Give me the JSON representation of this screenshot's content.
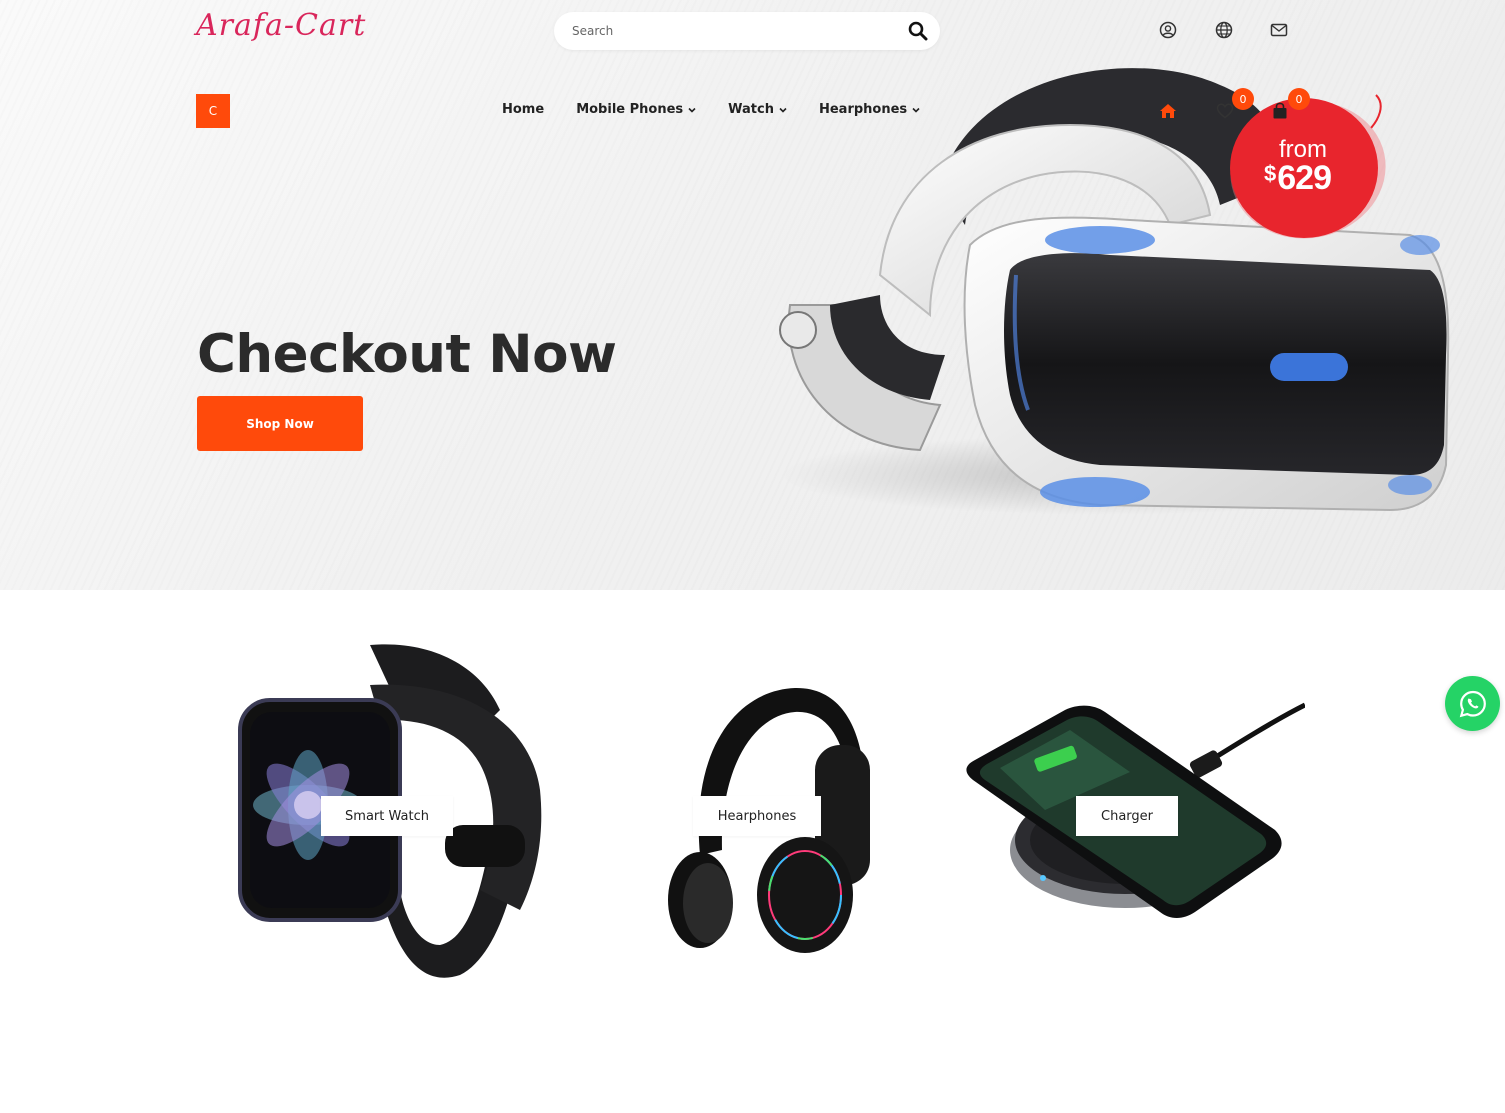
{
  "header": {
    "logo": "Arafa-Cart",
    "search_placeholder": "Search",
    "icons": [
      "user-icon",
      "globe-icon",
      "mail-icon"
    ]
  },
  "nav": {
    "category_button": "C",
    "items": [
      {
        "label": "Home",
        "dropdown": false
      },
      {
        "label": "Mobile Phones",
        "dropdown": true
      },
      {
        "label": "Watch",
        "dropdown": true
      },
      {
        "label": "Hearphones",
        "dropdown": true
      }
    ],
    "right_icons": [
      "home-icon",
      "heart-icon",
      "shopping-bag-icon"
    ],
    "wishlist_count": "0",
    "cart_count": "0"
  },
  "hero": {
    "title": "Checkout Now",
    "button": "Shop Now",
    "price_from": "from",
    "price_currency": "$",
    "price_amount": "629"
  },
  "categories": [
    {
      "label": "Smart Watch"
    },
    {
      "label": "Hearphones"
    },
    {
      "label": "Charger"
    }
  ],
  "colors": {
    "accent": "#ff4a0b",
    "logo": "#d9265b",
    "price_badge": "#e8252d",
    "whatsapp": "#25d366"
  }
}
